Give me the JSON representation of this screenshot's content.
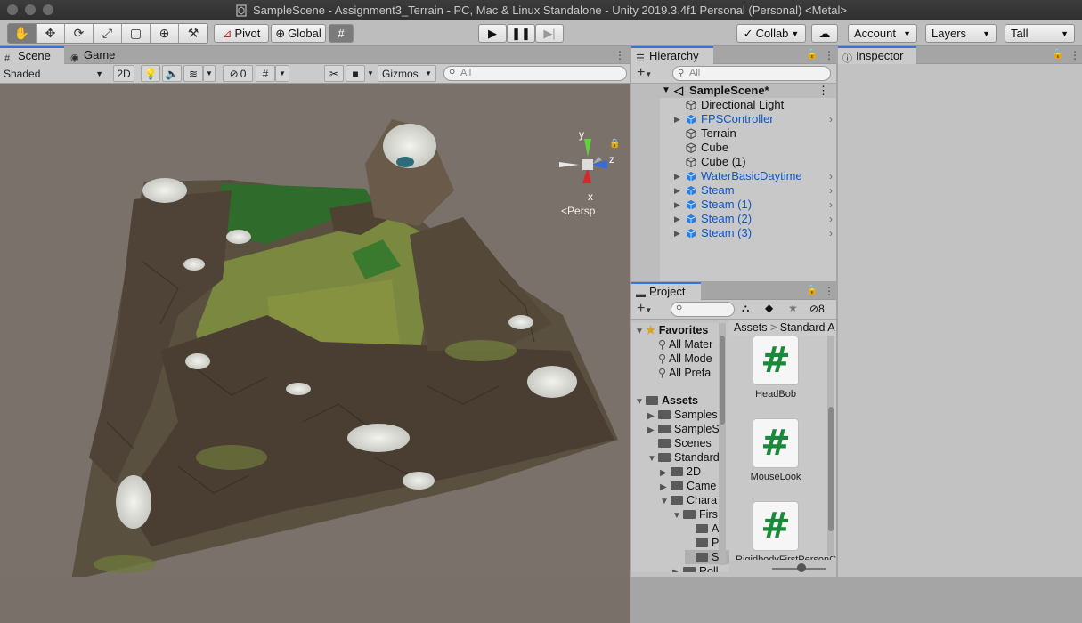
{
  "window": {
    "title": "SampleScene - Assignment3_Terrain - PC, Mac & Linux Standalone - Unity 2019.3.4f1 Personal (Personal) <Metal>"
  },
  "toolbar": {
    "pivot_label": "Pivot",
    "global_label": "Global",
    "collab_label": "Collab",
    "account_label": "Account",
    "layers_label": "Layers",
    "layout_label": "Tall",
    "accent_color": "#3a72d4"
  },
  "scene_tabs": {
    "scene_label": "Scene",
    "game_label": "Game"
  },
  "scene_toolbar": {
    "shading_mode": "Shaded",
    "mode_2d": "2D",
    "hidden_count": "0",
    "gizmos_label": "Gizmos",
    "search_placeholder": "All"
  },
  "scene_gizmo": {
    "y_label": "y",
    "x_label": "x",
    "z_label": "z",
    "projection_label": "Persp"
  },
  "hierarchy": {
    "tab_label": "Hierarchy",
    "search_placeholder": "All",
    "scene_name": "SampleScene*",
    "items": [
      {
        "label": "Directional Light",
        "prefab": false,
        "has_children": false
      },
      {
        "label": "FPSController",
        "prefab": true,
        "has_children": true
      },
      {
        "label": "Terrain",
        "prefab": false,
        "has_children": false
      },
      {
        "label": "Cube",
        "prefab": false,
        "has_children": false
      },
      {
        "label": "Cube (1)",
        "prefab": false,
        "has_children": false
      },
      {
        "label": "WaterBasicDaytime",
        "prefab": true,
        "has_children": true
      },
      {
        "label": "Steam",
        "prefab": true,
        "has_children": true
      },
      {
        "label": "Steam (1)",
        "prefab": true,
        "has_children": true
      },
      {
        "label": "Steam (2)",
        "prefab": true,
        "has_children": true
      },
      {
        "label": "Steam (3)",
        "prefab": true,
        "has_children": true
      }
    ]
  },
  "inspector": {
    "tab_label": "Inspector"
  },
  "project": {
    "tab_label": "Project",
    "hidden_count": "8",
    "breadcrumb": [
      "Assets",
      "Standard A"
    ],
    "favorites_label": "Favorites",
    "favorites": [
      "All Mater",
      "All Mode",
      "All Prefa"
    ],
    "assets_label": "Assets",
    "tree": [
      "Samples",
      "SampleS",
      "Scenes",
      "Standard",
      "2D",
      "Came",
      "Chara",
      "Firs",
      "A",
      "P",
      "S",
      "Roll"
    ],
    "assets": [
      {
        "name": "HeadBob",
        "icon": "#"
      },
      {
        "name": "MouseLook",
        "icon": "#"
      },
      {
        "name": "RigidbodyFirstPersonController",
        "icon": "#"
      }
    ]
  }
}
